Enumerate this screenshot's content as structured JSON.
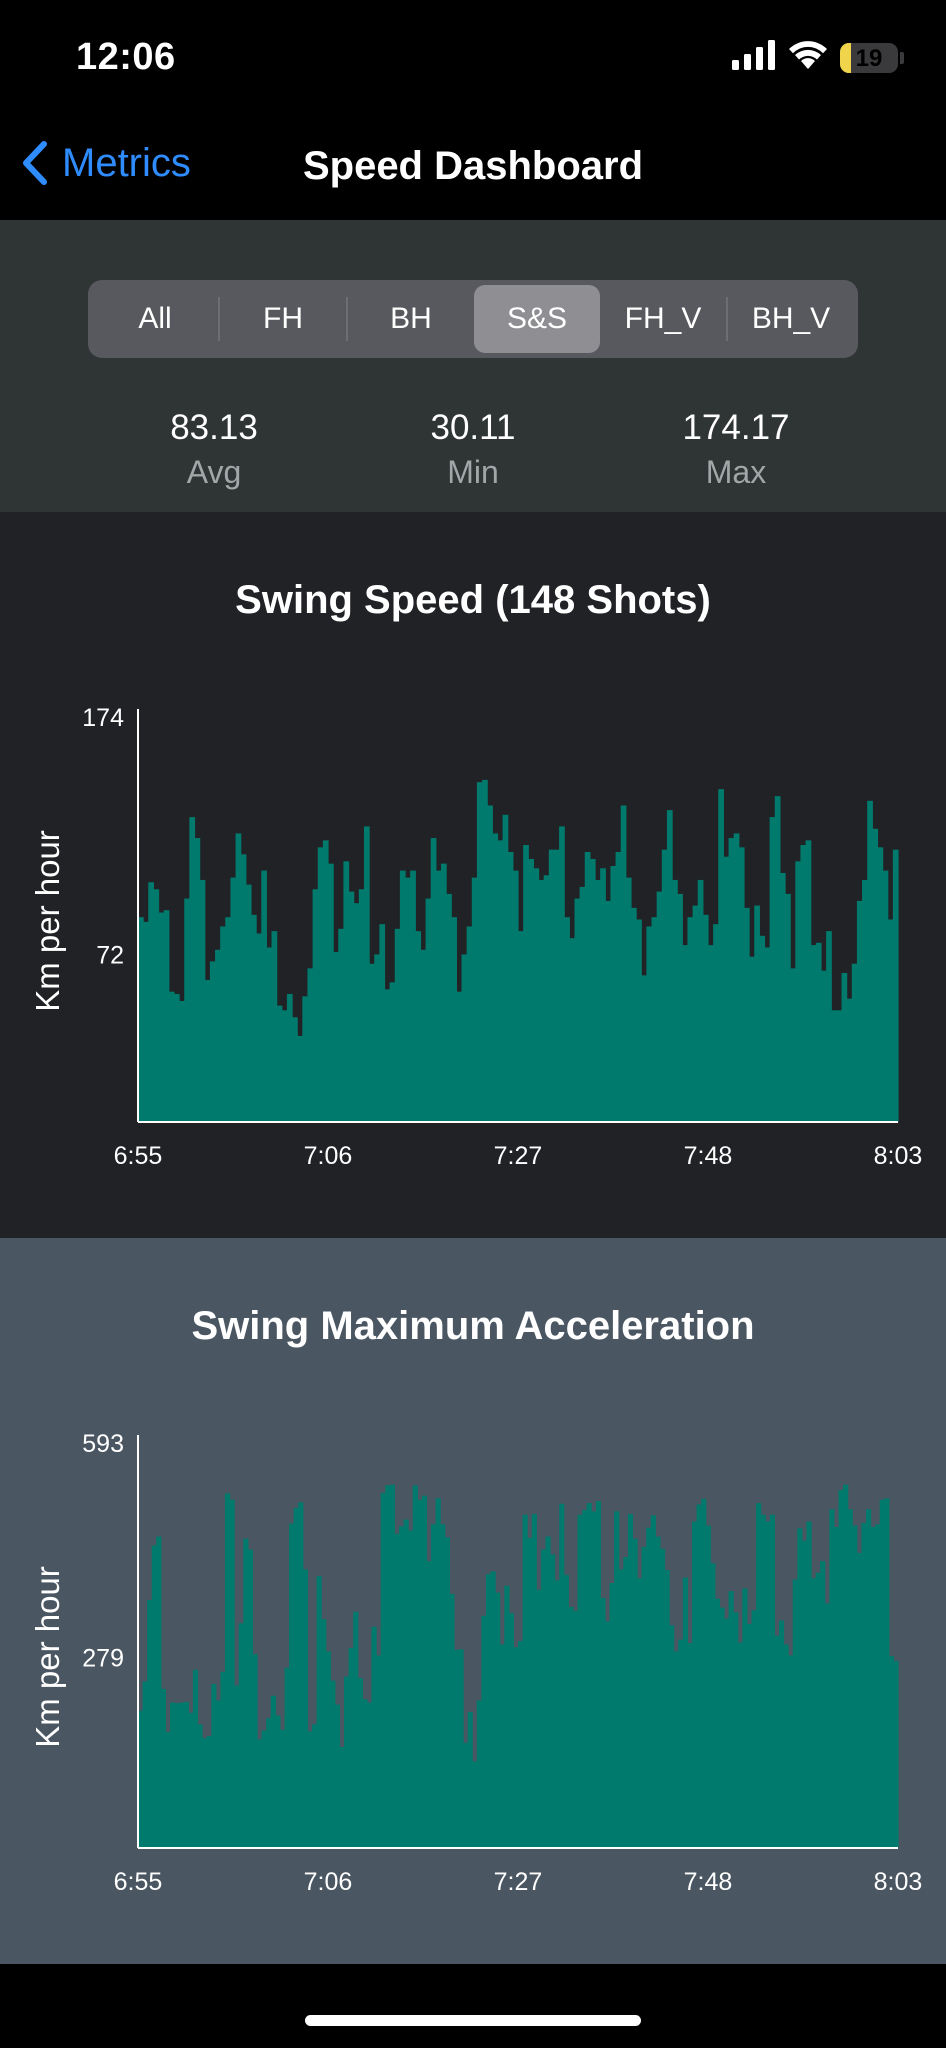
{
  "status": {
    "time": "12:06",
    "battery": "19"
  },
  "nav": {
    "back_label": "Metrics",
    "title": "Speed Dashboard"
  },
  "tabs": [
    {
      "label": "All",
      "active": false
    },
    {
      "label": "FH",
      "active": false
    },
    {
      "label": "BH",
      "active": false
    },
    {
      "label": "S&S",
      "active": true
    },
    {
      "label": "FH_V",
      "active": false
    },
    {
      "label": "BH_V",
      "active": false
    }
  ],
  "stats": [
    {
      "value": "83.13",
      "label": "Avg"
    },
    {
      "value": "30.11",
      "label": "Min"
    },
    {
      "value": "174.17",
      "label": "Max"
    }
  ],
  "colors": {
    "bar": "#007a6c",
    "accent": "#2f8cff"
  },
  "chart_data": [
    {
      "type": "bar",
      "title": "Swing Speed (148 Shots)",
      "ylabel": "Km per hour",
      "xlabel": "",
      "x_ticks": [
        "6:55",
        "7:06",
        "7:27",
        "7:48",
        "8:03"
      ],
      "y_ticks": [
        72,
        174
      ],
      "ylim": [
        0,
        174
      ],
      "values": [
        88,
        86,
        103,
        100,
        90,
        91,
        56,
        55,
        52,
        96,
        131,
        122,
        104,
        61,
        69,
        74,
        84,
        88,
        105,
        124,
        115,
        102,
        89,
        81,
        108,
        75,
        82,
        50,
        48,
        55,
        45,
        37,
        54,
        66,
        100,
        118,
        121,
        111,
        73,
        83,
        112,
        99,
        94,
        100,
        127,
        68,
        72,
        85,
        57,
        60,
        83,
        108,
        105,
        108,
        82,
        74,
        96,
        122,
        108,
        111,
        98,
        88,
        56,
        72,
        84,
        105,
        146,
        147,
        136,
        124,
        121,
        132,
        116,
        108,
        82,
        119,
        113,
        109,
        104,
        106,
        117,
        117,
        127,
        88,
        79,
        96,
        101,
        116,
        113,
        104,
        109,
        95,
        110,
        116,
        136,
        105,
        92,
        87,
        63,
        84,
        88,
        99,
        117,
        134,
        104,
        98,
        76,
        88,
        93,
        104,
        89,
        76,
        85,
        143,
        114,
        122,
        124,
        118,
        92,
        71,
        93,
        80,
        75,
        131,
        140,
        107,
        98,
        66,
        112,
        119,
        121,
        76,
        77,
        65,
        82,
        48,
        48,
        64,
        53,
        68,
        95,
        104,
        138,
        126,
        118,
        108,
        87,
        117
      ],
      "color": "#007a6c"
    },
    {
      "type": "bar",
      "title": "Swing Maximum Acceleration",
      "ylabel": "Km per hour",
      "xlabel": "",
      "x_ticks": [
        "6:55",
        "7:06",
        "7:27",
        "7:48",
        "8:03"
      ],
      "y_ticks": [
        279,
        593
      ],
      "ylim": [
        0,
        593
      ],
      "values": [
        201,
        244,
        363,
        443,
        456,
        233,
        170,
        213,
        212,
        213,
        214,
        198,
        261,
        181,
        161,
        164,
        240,
        216,
        258,
        519,
        510,
        238,
        329,
        453,
        437,
        284,
        159,
        172,
        190,
        223,
        194,
        173,
        264,
        475,
        498,
        506,
        408,
        171,
        181,
        398,
        335,
        288,
        245,
        210,
        148,
        251,
        293,
        346,
        249,
        218,
        213,
        324,
        282,
        520,
        531,
        532,
        460,
        471,
        481,
        465,
        531,
        510,
        516,
        420,
        474,
        512,
        474,
        455,
        372,
        290,
        291,
        154,
        199,
        127,
        216,
        340,
        401,
        405,
        374,
        298,
        384,
        344,
        294,
        303,
        488,
        454,
        489,
        378,
        437,
        456,
        430,
        392,
        504,
        400,
        353,
        347,
        488,
        495,
        505,
        493,
        508,
        366,
        332,
        388,
        493,
        408,
        426,
        489,
        453,
        395,
        441,
        469,
        487,
        456,
        438,
        407,
        326,
        288,
        305,
        396,
        300,
        478,
        503,
        511,
        472,
        417,
        365,
        352,
        336,
        376,
        345,
        301,
        380,
        328,
        348,
        505,
        488,
        478,
        488,
        311,
        333,
        298,
        282,
        393,
        468,
        450,
        478,
        395,
        403,
        420,
        358,
        496,
        470,
        524,
        532,
        496,
        472,
        432,
        476,
        496,
        470,
        474,
        510,
        512,
        281,
        274
      ]
    }
  ]
}
